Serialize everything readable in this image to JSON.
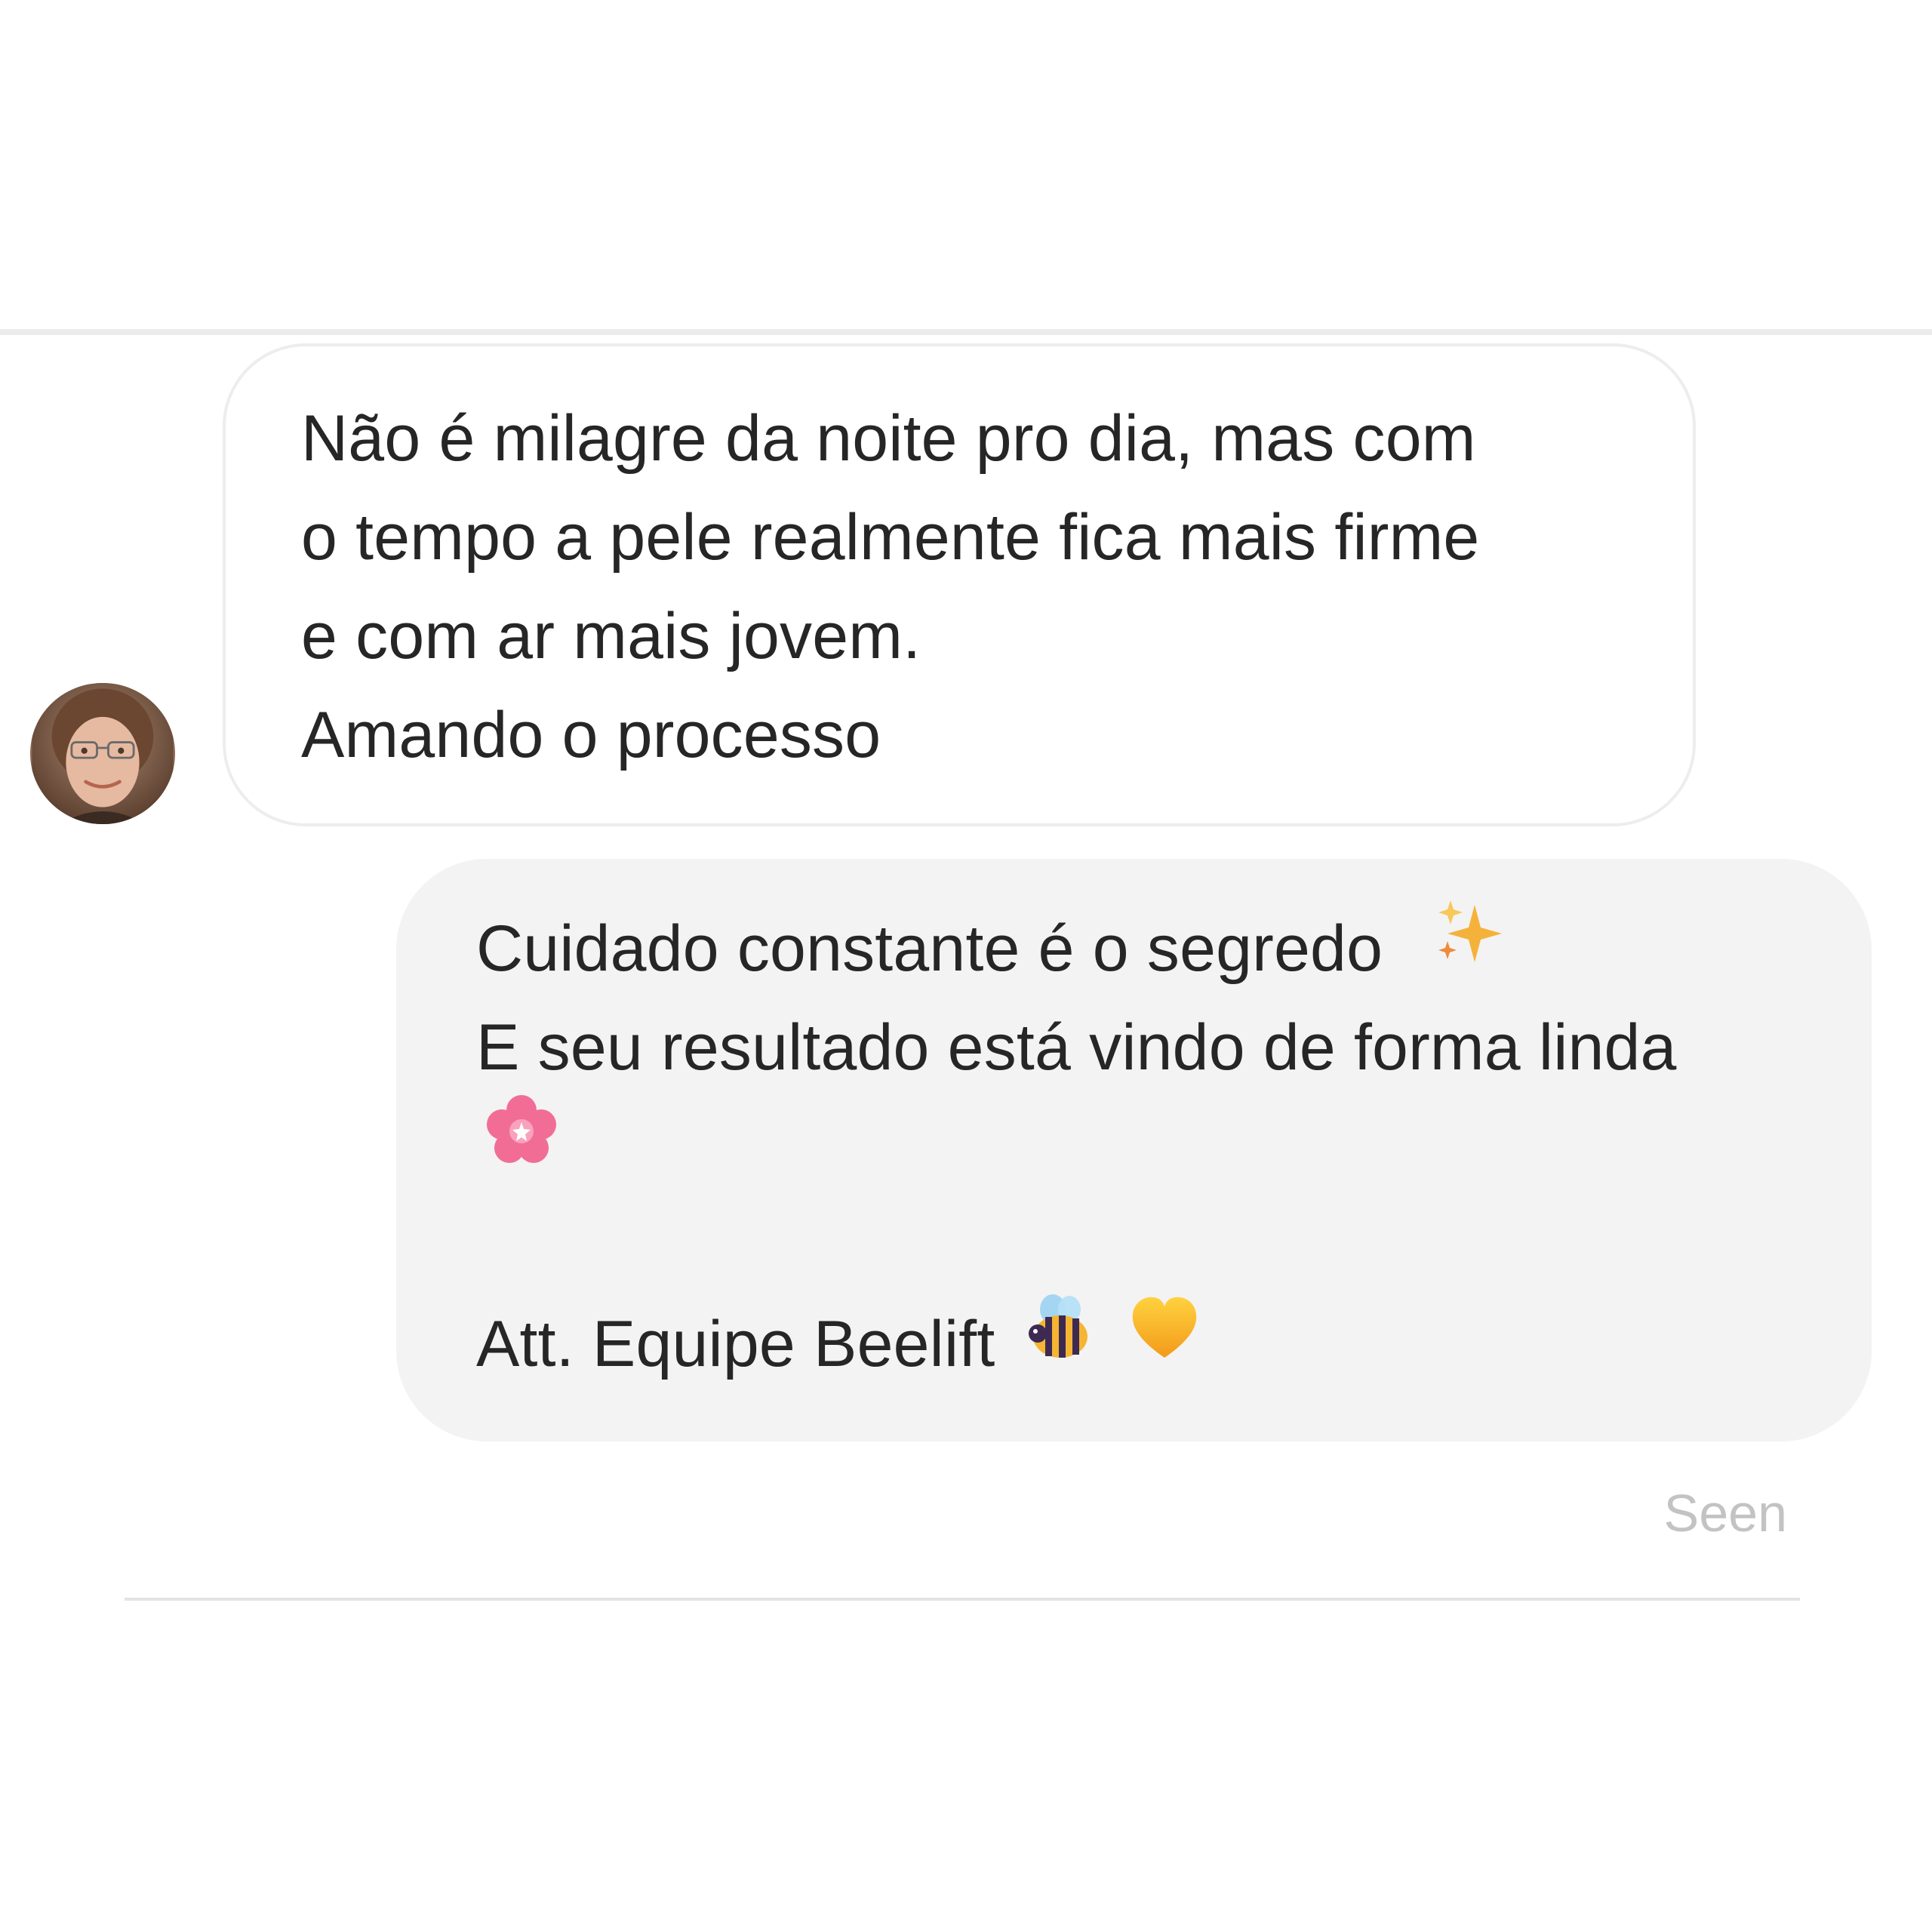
{
  "conversation": {
    "incoming": {
      "lines": [
        "Não é milagre da noite pro dia, mas com",
        "o tempo a pele realmente fica mais firme",
        "e com ar mais jovem.",
        "Amando o processo"
      ]
    },
    "outgoing": {
      "line1": "Cuidado constante é o segredo",
      "line2": "E seu resultado está vindo de forma linda",
      "line4": "Att. Equipe Beelift",
      "emojis": [
        "sparkles-emoji",
        "cherry-blossom-emoji",
        "bee-emoji",
        "yellow-heart-emoji"
      ]
    },
    "status": "Seen"
  },
  "colors": {
    "incoming_bubble_bg": "#ffffff",
    "incoming_bubble_border": "#ededed",
    "outgoing_bubble_bg": "#f3f3f3",
    "text": "#262626",
    "seen_text": "#c3c3c3"
  }
}
